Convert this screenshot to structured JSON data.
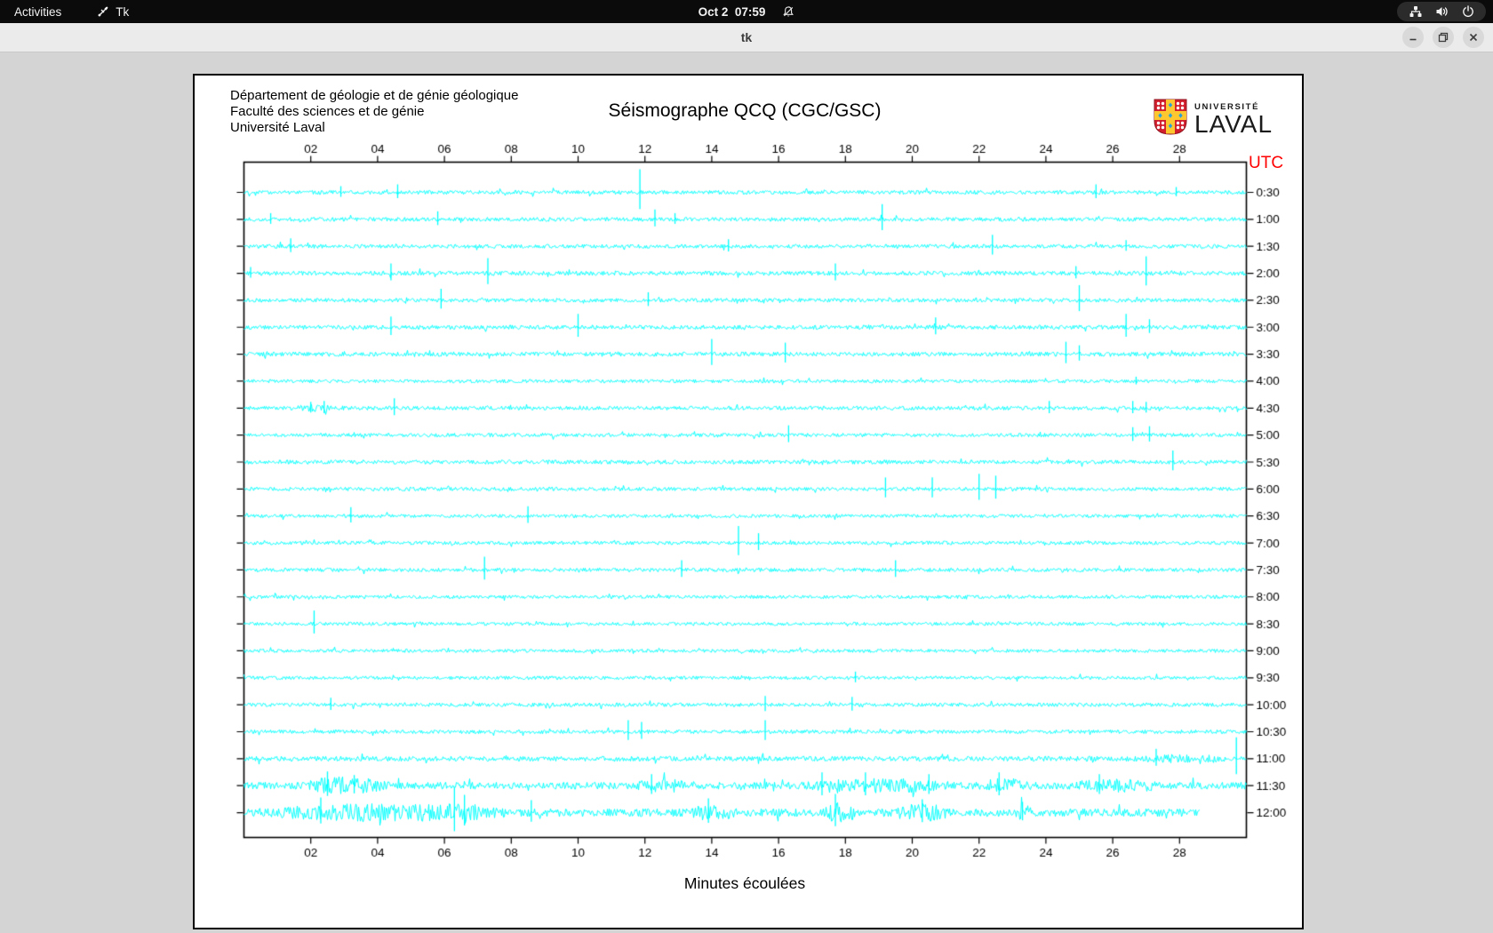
{
  "top_bar": {
    "activities": "Activities",
    "app_name": "Tk",
    "clock": "Oct 2  07:59"
  },
  "title_bar": {
    "title": "tk"
  },
  "window": {
    "header_lines": [
      "Département de géologie et de génie géologique",
      "Faculté des sciences et de génie",
      "Université Laval"
    ],
    "title": "Séismographe QCQ (CGC/GSC)",
    "logo": {
      "small": "UNIVERSITÉ",
      "large": "LAVAL"
    },
    "utc_label": "UTC",
    "x_axis_label": "Minutes écoulées"
  },
  "colors": {
    "trace": "#00ffff",
    "axis": "#000000",
    "utc": "#ff0000",
    "logo_red": "#d21f2e",
    "logo_gold": "#fdc82f",
    "logo_blue": "#2a9fdc"
  },
  "chart_data": {
    "type": "line",
    "title": "Séismographe QCQ (CGC/GSC)",
    "xlabel": "Minutes écoulées",
    "ylabel_right": "UTC",
    "x_range": [
      0,
      30
    ],
    "grid": false,
    "x_ticks_minutes": [
      2,
      4,
      6,
      8,
      10,
      12,
      14,
      16,
      18,
      20,
      22,
      24,
      26,
      28
    ],
    "x_tick_labels": [
      "02",
      "04",
      "06",
      "08",
      "10",
      "12",
      "14",
      "16",
      "18",
      "20",
      "22",
      "24",
      "26",
      "28"
    ],
    "traces": [
      {
        "label": "0:30",
        "amp": 2.2,
        "spikes": [
          [
            2.9,
            7
          ],
          [
            4.6,
            9
          ],
          [
            11.85,
            26
          ],
          [
            25.5,
            9
          ],
          [
            27.9,
            6
          ]
        ]
      },
      {
        "label": "1:00",
        "amp": 2.2,
        "spikes": [
          [
            0.8,
            7
          ],
          [
            5.8,
            9
          ],
          [
            12.3,
            11
          ],
          [
            12.9,
            7
          ],
          [
            19.1,
            17
          ]
        ]
      },
      {
        "label": "1:30",
        "amp": 2.2,
        "spikes": [
          [
            1.4,
            9
          ],
          [
            14.5,
            8
          ],
          [
            22.4,
            13
          ],
          [
            26.4,
            7
          ]
        ]
      },
      {
        "label": "2:00",
        "amp": 2.4,
        "spikes": [
          [
            0.2,
            7
          ],
          [
            4.4,
            11
          ],
          [
            7.3,
            17
          ],
          [
            17.7,
            11
          ],
          [
            24.9,
            8
          ],
          [
            27.0,
            19
          ]
        ]
      },
      {
        "label": "2:30",
        "amp": 2.2,
        "spikes": [
          [
            5.9,
            13
          ],
          [
            12.1,
            9
          ],
          [
            25.0,
            17
          ]
        ]
      },
      {
        "label": "3:00",
        "amp": 2.4,
        "spikes": [
          [
            4.4,
            12
          ],
          [
            10.0,
            15
          ],
          [
            20.7,
            11
          ],
          [
            26.4,
            15
          ],
          [
            27.1,
            9
          ]
        ]
      },
      {
        "label": "3:30",
        "amp": 2.4,
        "spikes": [
          [
            14.0,
            17
          ],
          [
            16.2,
            13
          ],
          [
            24.6,
            14
          ],
          [
            25.0,
            10
          ]
        ]
      },
      {
        "label": "4:00",
        "amp": 1.9,
        "spikes": [
          [
            26.7,
            5
          ]
        ]
      },
      {
        "label": "4:30",
        "amp": 2.2,
        "spikes": [
          [
            2.0,
            7
          ],
          [
            2.4,
            8
          ],
          [
            4.5,
            11
          ],
          [
            24.1,
            8
          ],
          [
            26.6,
            8
          ],
          [
            27.0,
            7
          ]
        ],
        "bursts": [
          [
            1.5,
            2.8,
            2.0
          ]
        ]
      },
      {
        "label": "5:00",
        "amp": 2.1,
        "spikes": [
          [
            16.3,
            11
          ],
          [
            26.6,
            9
          ],
          [
            27.1,
            10
          ]
        ]
      },
      {
        "label": "5:30",
        "amp": 2.3,
        "spikes": [
          [
            27.8,
            13
          ]
        ]
      },
      {
        "label": "6:00",
        "amp": 2.1,
        "spikes": [
          [
            19.2,
            13
          ],
          [
            20.6,
            13
          ],
          [
            22.0,
            17
          ],
          [
            22.5,
            15
          ]
        ]
      },
      {
        "label": "6:30",
        "amp": 1.9,
        "spikes": [
          [
            3.2,
            10
          ],
          [
            8.5,
            11
          ]
        ]
      },
      {
        "label": "7:00",
        "amp": 2.0,
        "spikes": [
          [
            14.8,
            19
          ],
          [
            15.4,
            11
          ]
        ]
      },
      {
        "label": "7:30",
        "amp": 2.1,
        "spikes": [
          [
            7.2,
            15
          ],
          [
            13.1,
            11
          ],
          [
            19.5,
            11
          ]
        ]
      },
      {
        "label": "8:00",
        "amp": 1.9,
        "spikes": []
      },
      {
        "label": "8:30",
        "amp": 1.9,
        "spikes": [
          [
            2.1,
            15
          ]
        ]
      },
      {
        "label": "9:00",
        "amp": 1.9,
        "spikes": []
      },
      {
        "label": "9:30",
        "amp": 1.9,
        "spikes": [
          [
            18.3,
            7
          ]
        ]
      },
      {
        "label": "10:00",
        "amp": 2.1,
        "spikes": [
          [
            2.6,
            8
          ],
          [
            15.6,
            10
          ],
          [
            18.2,
            9
          ]
        ]
      },
      {
        "label": "10:30",
        "amp": 2.1,
        "spikes": [
          [
            11.5,
            13
          ],
          [
            11.9,
            11
          ],
          [
            15.6,
            13
          ]
        ]
      },
      {
        "label": "11:00",
        "amp": 2.8,
        "spikes": [
          [
            27.3,
            11
          ],
          [
            29.7,
            24
          ]
        ],
        "bursts": [
          [
            26.5,
            30,
            1.8
          ]
        ]
      },
      {
        "label": "11:30",
        "amp": 4.0,
        "spikes": [
          [
            2.5,
            16
          ],
          [
            3.3,
            12
          ],
          [
            12.2,
            13
          ],
          [
            17.3,
            15
          ],
          [
            18.6,
            15
          ],
          [
            20.5,
            13
          ],
          [
            22.6,
            15
          ],
          [
            25.6,
            13
          ]
        ],
        "bursts": [
          [
            1.6,
            4.4,
            2.6
          ],
          [
            11.6,
            13.6,
            2.0
          ],
          [
            16.6,
            21.4,
            2.2
          ],
          [
            22.0,
            23.6,
            2.2
          ],
          [
            24.6,
            27.6,
            2.0
          ]
        ]
      },
      {
        "label": "12:00",
        "amp": 4.5,
        "end": 28.6,
        "spikes": [
          [
            2.3,
            17
          ],
          [
            6.3,
            29
          ],
          [
            6.6,
            20
          ],
          [
            8.6,
            14
          ],
          [
            13.9,
            16
          ],
          [
            17.7,
            21
          ],
          [
            20.3,
            15
          ],
          [
            23.3,
            12
          ]
        ],
        "bursts": [
          [
            0.3,
            8.2,
            2.4
          ],
          [
            5.6,
            7.2,
            3.0
          ],
          [
            13.2,
            14.8,
            2.0
          ],
          [
            17.3,
            18.4,
            2.6
          ],
          [
            19.4,
            21.2,
            2.4
          ],
          [
            22.9,
            23.8,
            1.8
          ]
        ]
      }
    ]
  }
}
